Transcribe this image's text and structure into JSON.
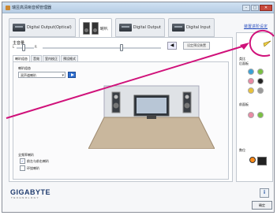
{
  "window": {
    "title": "瑞昱高清晰音频管理器",
    "controls": {
      "minimize": "–",
      "maximize": "□",
      "close": "✕"
    }
  },
  "device_tabs": [
    {
      "label": "Digital Output(Optical)",
      "active": false
    },
    {
      "label": "喇叭",
      "active": true
    },
    {
      "label": "Digital Output",
      "active": false
    },
    {
      "label": "Digital Input",
      "active": false
    }
  ],
  "device_advanced_link": "装置进阶设定",
  "volume": {
    "label": "主音量",
    "left": "L",
    "right": "R",
    "set_default": "设定预设装置",
    "mute_icon": "speaker-icon"
  },
  "sub_tabs": [
    "喇叭组态",
    "音效",
    "室内校正",
    "预设格式"
  ],
  "speaker_config": {
    "label": "喇叭组态",
    "selected": "双声道喇叭",
    "fullrange_label": "全频率喇叭",
    "options": [
      {
        "label": "前左与前右喇叭",
        "checked": true
      },
      {
        "label": "环绕喇叭",
        "checked": false
      }
    ]
  },
  "right_panel": {
    "analog_label": "类比",
    "back_label": "后面板",
    "front_label": "前面板",
    "digital_label": "数位",
    "jack_colors_back": [
      "#3aa0d6",
      "#7ac043",
      "#e88aa4",
      "#222222",
      "#e8c23a",
      "#9a9a9a"
    ],
    "jack_colors_front": [
      "#e88aa4",
      "#7ac043"
    ]
  },
  "footer": {
    "brand": "GIGABYTE",
    "brand_sub": "TECHNOLOGY",
    "info_button": "i",
    "ok_button": "确定"
  },
  "colors": {
    "accent": "#2f6fd0",
    "pointer_line": "#d0117a",
    "link": "#2a4fbf"
  }
}
